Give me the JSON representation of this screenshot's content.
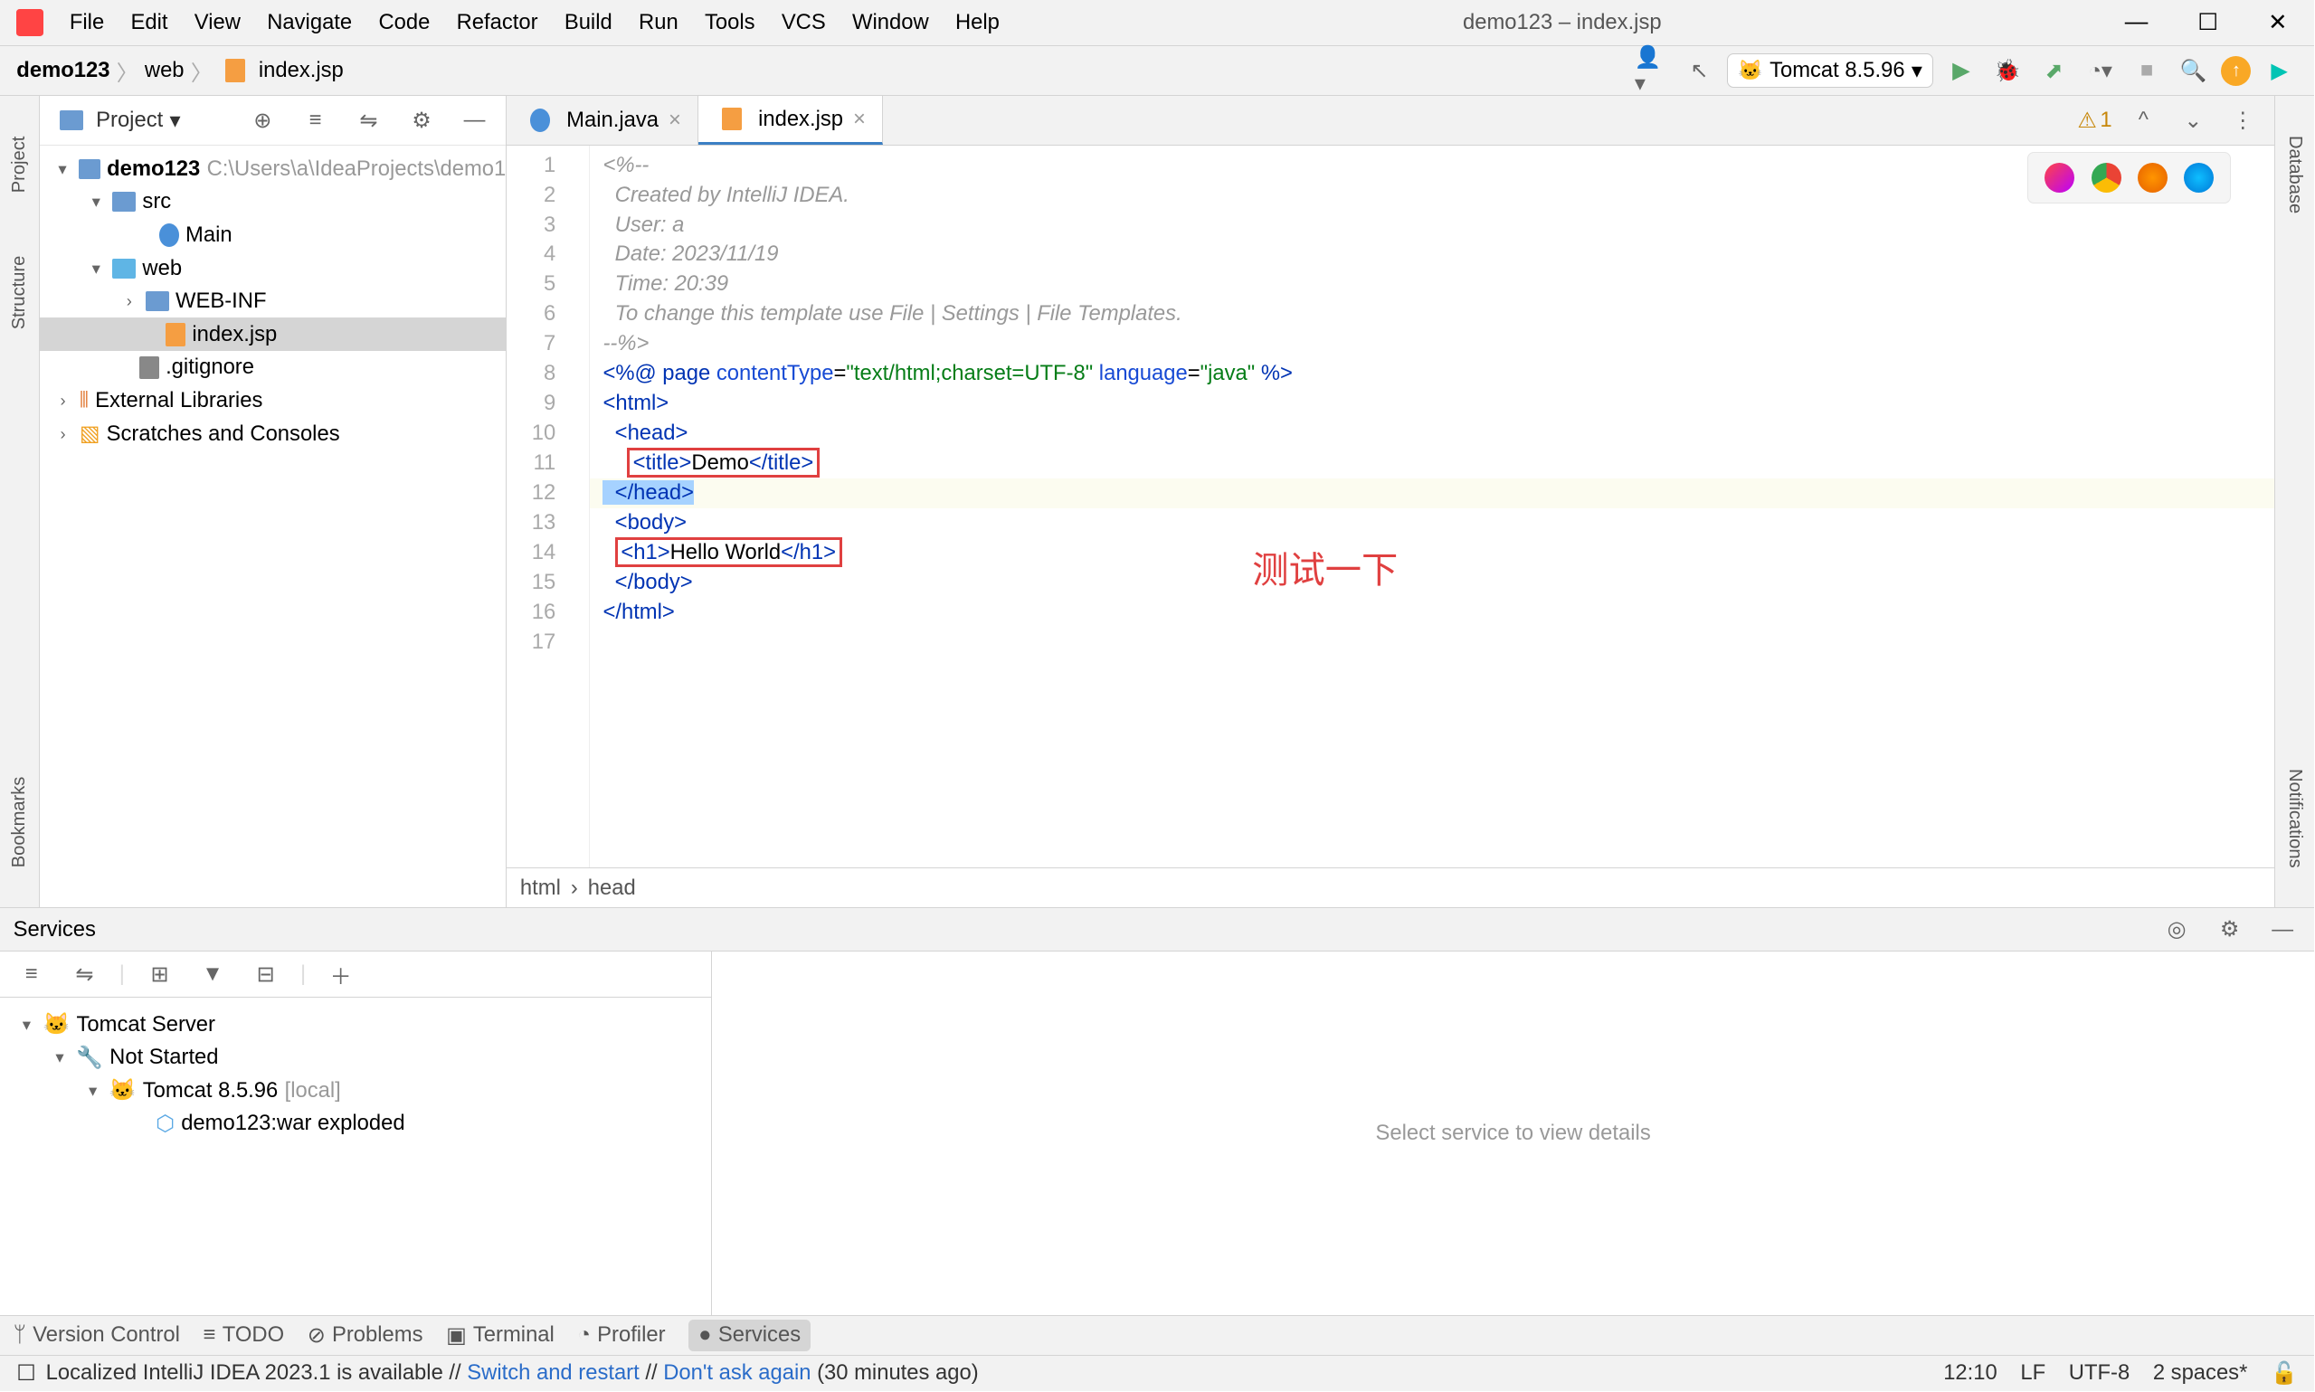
{
  "window_title": "demo123 – index.jsp",
  "menus": [
    "File",
    "Edit",
    "View",
    "Navigate",
    "Code",
    "Refactor",
    "Build",
    "Run",
    "Tools",
    "VCS",
    "Window",
    "Help"
  ],
  "breadcrumbs": {
    "project": "demo123",
    "folder": "web",
    "file": "index.jsp"
  },
  "run_config": "Tomcat 8.5.96",
  "side_left": {
    "project": "Project",
    "structure": "Structure",
    "bookmarks": "Bookmarks"
  },
  "side_right": {
    "database": "Database",
    "notifications": "Notifications"
  },
  "project_panel": {
    "title": "Project",
    "root": "demo123",
    "root_path": "C:\\Users\\a\\IdeaProjects\\demo1",
    "src": "src",
    "main": "Main",
    "web": "web",
    "webinf": "WEB-INF",
    "indexjsp": "index.jsp",
    "gitignore": ".gitignore",
    "extlib": "External Libraries",
    "scratches": "Scratches and Consoles"
  },
  "tabs": {
    "main": "Main.java",
    "index": "index.jsp"
  },
  "warning_count": "1",
  "code": {
    "l1": "<%--",
    "l2": "  Created by IntelliJ IDEA.",
    "l3": "  User: a",
    "l4": "  Date: 2023/11/19",
    "l5": "  Time: 20:39",
    "l6": "  To change this template use File | Settings | File Templates.",
    "l7": "--%>",
    "l8a": "<%@ ",
    "l8b": "page ",
    "l8c": "contentType",
    "l8d": "=",
    "l8e": "\"text/html;charset=UTF-8\"",
    "l8f": " language",
    "l8g": "=",
    "l8h": "\"java\"",
    "l8i": " %>",
    "l9": "<html>",
    "l10": "  <head>",
    "l11a": "    ",
    "l11b": "<title>",
    "l11c": "Demo",
    "l11d": "</title>",
    "l12": "  </head>",
    "l13": "  <body>",
    "l14a": "  ",
    "l14b": "<h1>",
    "l14c": "Hello World",
    "l14d": "</h1>",
    "l15": "  </body>",
    "l16": "</html>"
  },
  "annotation": "测试一下",
  "crumb": {
    "a": "html",
    "b": "head"
  },
  "services": {
    "title": "Services",
    "detail": "Select service to view details",
    "tomcat_server": "Tomcat Server",
    "not_started": "Not Started",
    "tomcat_item": "Tomcat 8.5.96",
    "local": "[local]",
    "artifact": "demo123:war exploded"
  },
  "bottom_tools": {
    "vc": "Version Control",
    "todo": "TODO",
    "problems": "Problems",
    "terminal": "Terminal",
    "profiler": "Profiler",
    "services": "Services"
  },
  "status": {
    "msg_a": "Localized IntelliJ IDEA 2023.1 is available // ",
    "msg_b": "Switch and restart",
    "msg_c": " // ",
    "msg_d": "Don't ask again",
    "msg_e": " (30 minutes ago)",
    "pos": "12:10",
    "lf": "LF",
    "enc": "UTF-8",
    "indent": "2 spaces*"
  }
}
